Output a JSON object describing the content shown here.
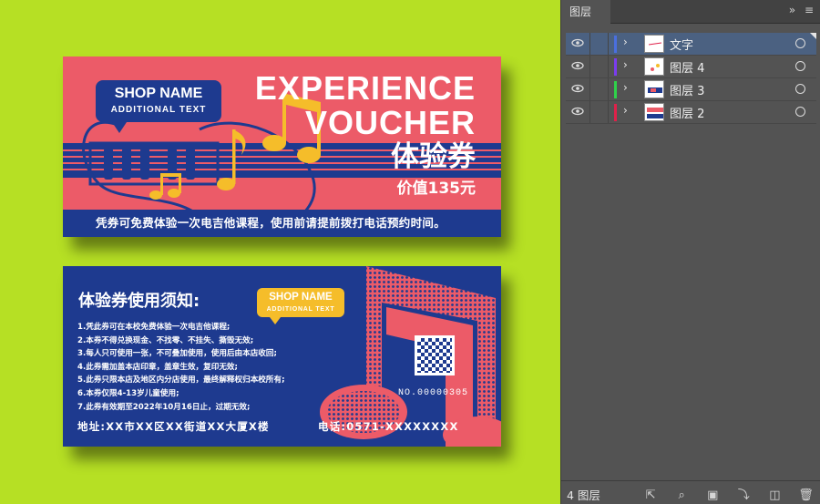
{
  "front": {
    "badge": {
      "shop_name": "SHOP NAME",
      "additional_text": "ADDITIONAL TEXT"
    },
    "title_line1": "EXPERIENCE",
    "title_line2": "VOUCHER",
    "title_cn": "体验券",
    "price": "价值135元",
    "note": "凭券可免费体验一次电吉他课程，使用前请提前拨打电话预约时间。"
  },
  "back": {
    "title": "体验券使用须知:",
    "badge": {
      "shop_name": "SHOP NAME",
      "additional_text": "ADDITIONAL TEXT"
    },
    "rules": [
      "1.凭此券可在本校免费体验一次电吉他课程;",
      "2.本券不得兑换现金、不找零、不挂失、撕毁无效;",
      "3.每人只可使用一张，不可叠加使用，使用后由本店收回;",
      "4.此券需加盖本店印章，盖章生效，复印无效;",
      "5.此券只限本店及地区内分店使用，最终解释权归本校所有;",
      "6.本券仅限4-13岁儿童使用;",
      "7.此券有效期至2022年10月16日止，过期无效;"
    ],
    "serial": "NO.00000305",
    "address": "地址:XX市XX区XX街道XX大厦X楼",
    "phone": "电话:0571-XXXXXXXX"
  },
  "colors": {
    "background": "#b6e024",
    "front": "#ec5b68",
    "navy": "#1e3a8f",
    "yellow": "#f5bd2a"
  },
  "panel": {
    "tab_label": "图层",
    "collapse_icon": "double-chevron-icon",
    "menu_icon": "hamburger-menu-icon",
    "layers": [
      {
        "name": "文字",
        "color": "#4a6fe0",
        "selected": true
      },
      {
        "name": "图层 4",
        "color": "#7b3cf0",
        "selected": false
      },
      {
        "name": "图层 3",
        "color": "#2fd24a",
        "selected": false
      },
      {
        "name": "图层 2",
        "color": "#e0214a",
        "selected": false
      }
    ],
    "footer": {
      "count": "4 图层",
      "icons": [
        "export-icon",
        "search-icon",
        "clipping-mask-icon",
        "new-sublayer-icon",
        "new-layer-icon",
        "trash-icon"
      ]
    }
  }
}
